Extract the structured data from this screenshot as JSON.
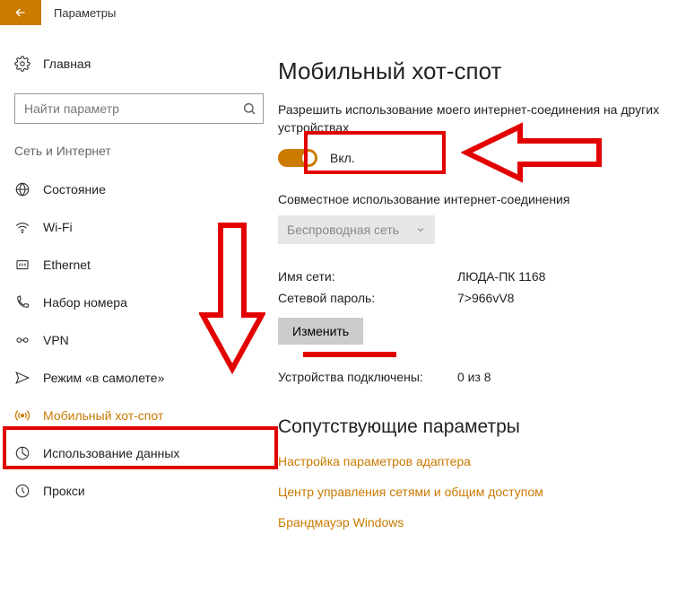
{
  "header": {
    "title": "Параметры"
  },
  "sidebar": {
    "home": "Главная",
    "search_placeholder": "Найти параметр",
    "section": "Сеть и Интернет",
    "items": [
      {
        "label": "Состояние"
      },
      {
        "label": "Wi-Fi"
      },
      {
        "label": "Ethernet"
      },
      {
        "label": "Набор номера"
      },
      {
        "label": "VPN"
      },
      {
        "label": "Режим «в самолете»"
      },
      {
        "label": "Мобильный хот-спот"
      },
      {
        "label": "Использование данных"
      },
      {
        "label": "Прокси"
      }
    ]
  },
  "main": {
    "title": "Мобильный хот-спот",
    "share_desc": "Разрешить использование моего интернет-соединения на других устройствах",
    "toggle_state": "Вкл.",
    "share_from_label": "Совместное использование интернет-соединения",
    "share_from_value": "Беспроводная сеть",
    "network_name_label": "Имя сети:",
    "network_name_value": "ЛЮДА-ПК 1168",
    "network_pass_label": "Сетевой пароль:",
    "network_pass_value": "7>966vV8",
    "edit_button": "Изменить",
    "devices_label": "Устройства подключены:",
    "devices_value": "0 из 8",
    "related_heading": "Сопутствующие параметры",
    "links": [
      "Настройка параметров адаптера",
      "Центр управления сетями и общим доступом",
      "Брандмауэр Windows"
    ]
  }
}
